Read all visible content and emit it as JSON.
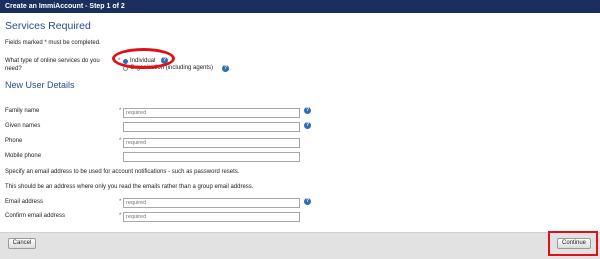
{
  "window": {
    "title": "Create an ImmiAccount - Step 1 of 2"
  },
  "services": {
    "heading": "Services Required",
    "required_note": "Fields marked * must be completed.",
    "question": "What type of online services do you need?",
    "options": [
      {
        "label": "Individual",
        "selected": true
      },
      {
        "label": "Organisation (including agents)",
        "selected": false
      }
    ]
  },
  "new_user": {
    "heading": "New User Details",
    "fields": {
      "family_name": {
        "label": "Family name",
        "required": true,
        "placeholder": "required",
        "value": ""
      },
      "given_names": {
        "label": "Given names",
        "required": false,
        "placeholder": "",
        "value": ""
      },
      "phone": {
        "label": "Phone",
        "required": true,
        "placeholder": "required",
        "value": ""
      },
      "mobile_phone": {
        "label": "Mobile phone",
        "required": false,
        "placeholder": "",
        "value": ""
      },
      "email": {
        "label": "Email address",
        "required": true,
        "placeholder": "required",
        "value": ""
      },
      "confirm_email": {
        "label": "Confirm email address",
        "required": true,
        "placeholder": "required",
        "value": ""
      }
    },
    "email_note_1": "Specify an email address to be used for account notifications - such as password resets.",
    "email_note_2": "This should be an address where only you read the emails rather than a group email address."
  },
  "footer": {
    "cancel_label": "Cancel",
    "continue_label": "Continue"
  },
  "icons": {
    "help": "help-icon",
    "required_marker": "*"
  },
  "colors": {
    "title_bar": "#1a2f5e",
    "heading": "#2c4d85",
    "help_icon": "#2f6db5",
    "highlight": "#e0101a",
    "required": "#c0392b"
  }
}
